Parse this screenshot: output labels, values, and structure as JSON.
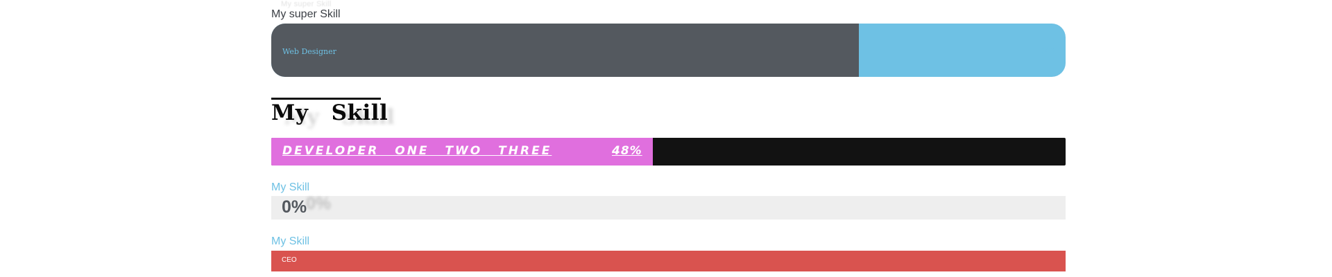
{
  "ghost_text": "My super Skill",
  "skill1": {
    "title": "My super Skill",
    "label": "Web Designer",
    "percent_text": "74%",
    "percent": 74,
    "fill_color": "#54595f",
    "track_color": "#6ec1e4",
    "text_color": "#6ec1e4"
  },
  "skill2": {
    "title": "My   Skill",
    "label": "DEVELOPER   ONE   TWO   THREE",
    "percent_text": "48%",
    "percent": 48,
    "fill_color": "#e06fde",
    "track_color": "#121212",
    "text_color": "#ffffff"
  },
  "skill3": {
    "title": "My Skill",
    "percent_text": "0%",
    "percent": 0,
    "track_color": "#eeeeee",
    "title_color": "#6ec1e4"
  },
  "skill4": {
    "title": "My Skill",
    "label": "CEO",
    "percent": 100,
    "fill_color": "#d9534f",
    "title_color": "#6ec1e4"
  }
}
